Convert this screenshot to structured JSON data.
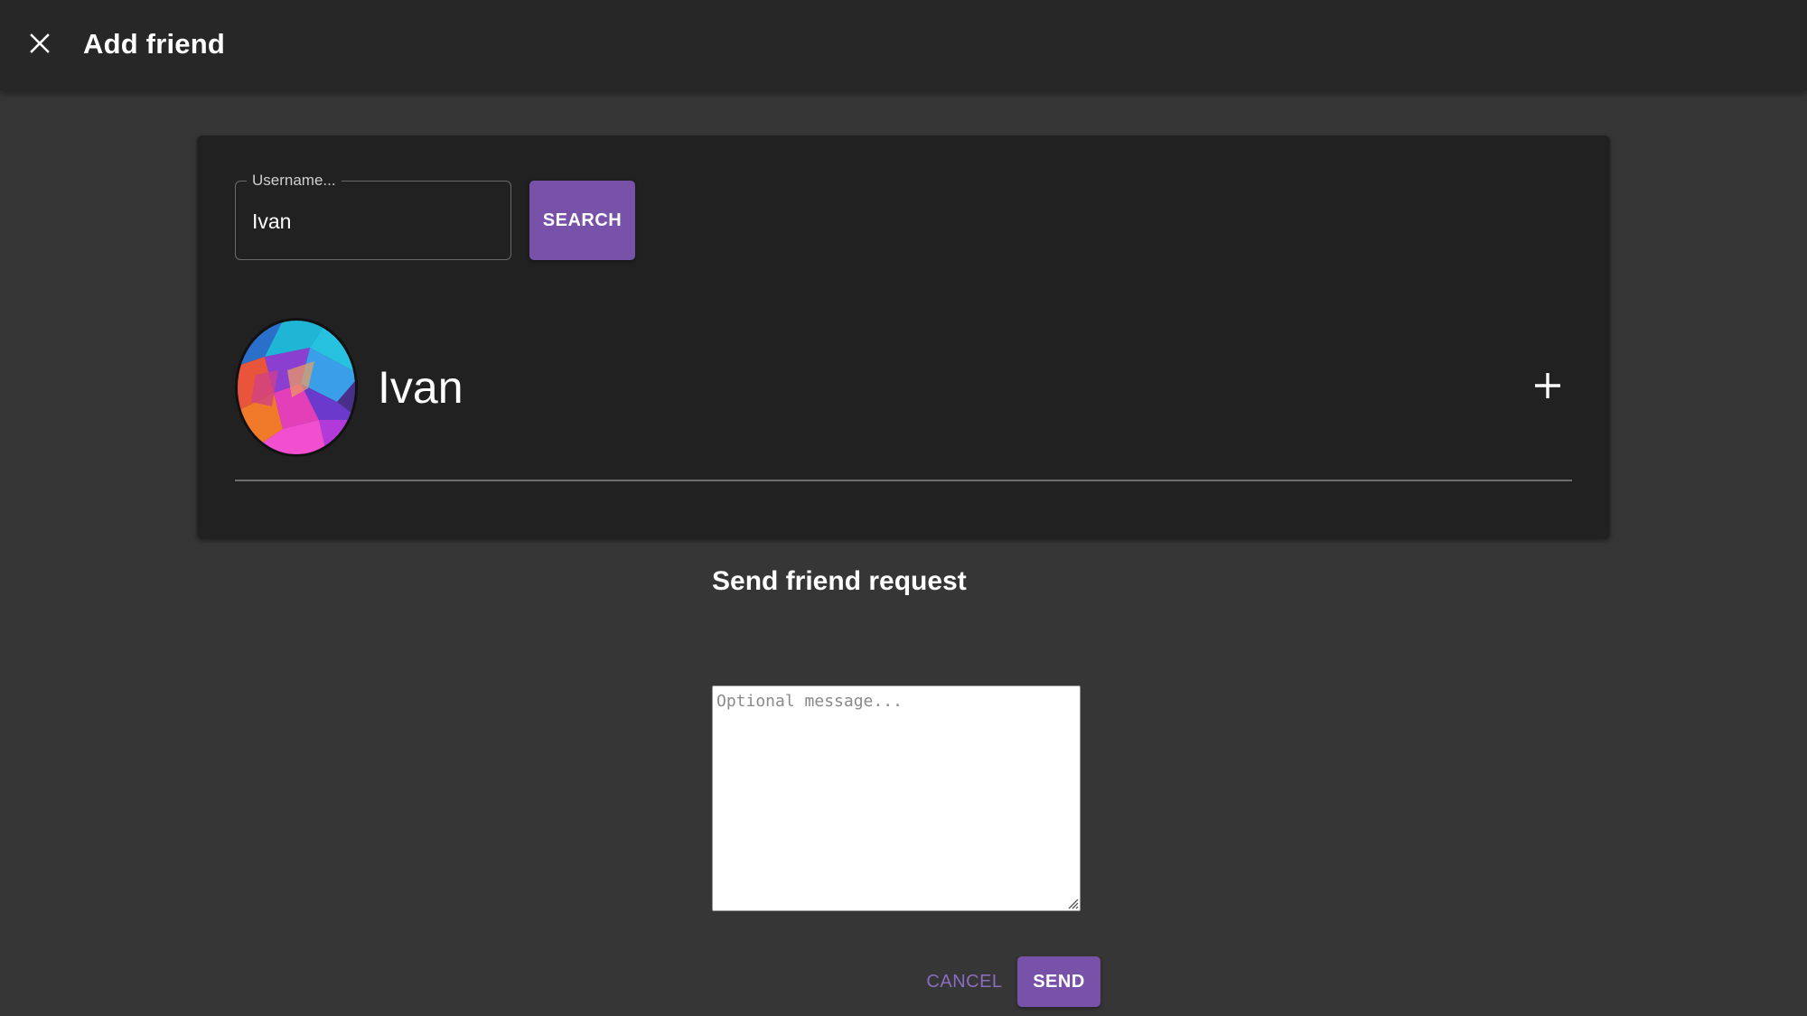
{
  "topbar": {
    "close_icon": "close-icon",
    "title": "Add friend"
  },
  "search": {
    "label": "Username...",
    "value": "Ivan",
    "button_label": "SEARCH"
  },
  "result": {
    "name": "Ivan",
    "avatar": "colorful-polygon-avatar",
    "add_icon": "plus-icon"
  },
  "request": {
    "title": "Send friend request",
    "message_placeholder": "Optional message...",
    "message_value": "",
    "cancel_label": "CANCEL",
    "send_label": "SEND"
  },
  "colors": {
    "accent": "#7752a8",
    "accent_text": "#8a6cc0",
    "background": "#363636",
    "surface": "#212121",
    "topbar": "#272727"
  }
}
